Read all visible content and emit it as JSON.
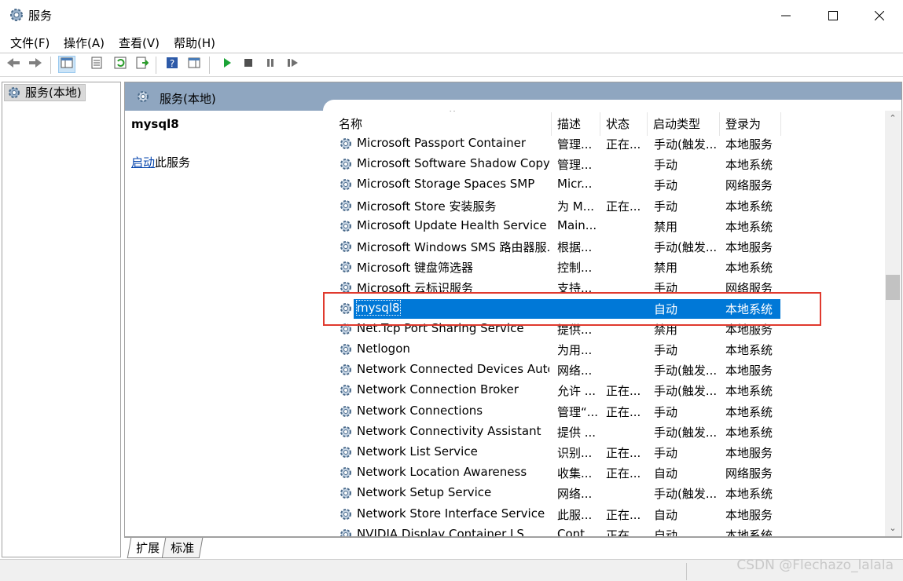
{
  "window": {
    "title": "服务",
    "icon": "services-gear-icon",
    "controls": [
      "minimize-icon",
      "maximize-icon",
      "close-icon"
    ]
  },
  "menu": [
    {
      "label": "文件(F)"
    },
    {
      "label": "操作(A)"
    },
    {
      "label": "查看(V)"
    },
    {
      "label": "帮助(H)"
    }
  ],
  "toolbar": {
    "icons": [
      "back-arrow-icon",
      "forward-arrow-icon",
      "show-hide-console-tree-icon",
      "properties-icon",
      "refresh-icon",
      "export-list-icon",
      "help-icon",
      "action-pane-icon",
      "start-service-icon",
      "stop-service-icon",
      "pause-service-icon",
      "restart-service-icon"
    ]
  },
  "tree": {
    "root_label": "服务(本地)"
  },
  "main": {
    "header_label": "服务(本地)",
    "selected_service": "mysql8",
    "start_link": "启动",
    "start_suffix": "此服务"
  },
  "columns": {
    "name": "名称",
    "desc": "描述",
    "status": "状态",
    "startup": "启动类型",
    "logon": "登录为"
  },
  "services": [
    {
      "name": "Microsoft Passport Container",
      "desc": "管理...",
      "status": "正在...",
      "startup": "手动(触发...",
      "logon": "本地服务"
    },
    {
      "name": "Microsoft Software Shadow Copy P...",
      "desc": "管理...",
      "status": "",
      "startup": "手动",
      "logon": "本地系统"
    },
    {
      "name": "Microsoft Storage Spaces SMP",
      "desc": "Micr...",
      "status": "",
      "startup": "手动",
      "logon": "网络服务"
    },
    {
      "name": "Microsoft Store 安装服务",
      "desc": "为 M...",
      "status": "正在...",
      "startup": "手动",
      "logon": "本地系统"
    },
    {
      "name": "Microsoft Update Health Service",
      "desc": "Main...",
      "status": "",
      "startup": "禁用",
      "logon": "本地系统"
    },
    {
      "name": "Microsoft Windows SMS 路由器服...",
      "desc": "根据...",
      "status": "",
      "startup": "手动(触发...",
      "logon": "本地服务"
    },
    {
      "name": "Microsoft 键盘筛选器",
      "desc": "控制...",
      "status": "",
      "startup": "禁用",
      "logon": "本地系统"
    },
    {
      "name": "Microsoft 云标识服务",
      "desc": "支持...",
      "status": "",
      "startup": "手动",
      "logon": "网络服务"
    },
    {
      "name": "mysql8",
      "desc": "",
      "status": "",
      "startup": "自动",
      "logon": "本地系统"
    },
    {
      "name": "Net.Tcp Port Sharing Service",
      "desc": "提供...",
      "status": "",
      "startup": "禁用",
      "logon": "本地服务"
    },
    {
      "name": "Netlogon",
      "desc": "为用...",
      "status": "",
      "startup": "手动",
      "logon": "本地系统"
    },
    {
      "name": "Network Connected Devices Auto...",
      "desc": "网络...",
      "status": "",
      "startup": "手动(触发...",
      "logon": "本地服务"
    },
    {
      "name": "Network Connection Broker",
      "desc": "允许 ...",
      "status": "正在...",
      "startup": "手动(触发...",
      "logon": "本地系统"
    },
    {
      "name": "Network Connections",
      "desc": "管理“...",
      "status": "正在...",
      "startup": "手动",
      "logon": "本地系统"
    },
    {
      "name": "Network Connectivity Assistant",
      "desc": "提供 ...",
      "status": "",
      "startup": "手动(触发...",
      "logon": "本地系统"
    },
    {
      "name": "Network List Service",
      "desc": "识别...",
      "status": "正在...",
      "startup": "手动",
      "logon": "本地服务"
    },
    {
      "name": "Network Location Awareness",
      "desc": "收集...",
      "status": "正在...",
      "startup": "自动",
      "logon": "网络服务"
    },
    {
      "name": "Network Setup Service",
      "desc": "网络...",
      "status": "",
      "startup": "手动(触发...",
      "logon": "本地系统"
    },
    {
      "name": "Network Store Interface Service",
      "desc": "此服...",
      "status": "正在...",
      "startup": "自动",
      "logon": "本地服务"
    },
    {
      "name": "NVIDIA Display Container LS",
      "desc": "Cont...",
      "status": "正在...",
      "startup": "自动",
      "logon": "本地系统"
    }
  ],
  "tabs": [
    {
      "label": "扩展"
    },
    {
      "label": "标准"
    }
  ],
  "watermark": "CSDN @Flechazo_lalala",
  "colors": {
    "selection": "#0078d7",
    "header_band": "#8fa6c0",
    "highlight_box": "#e03a2e",
    "link": "#0645ad"
  }
}
